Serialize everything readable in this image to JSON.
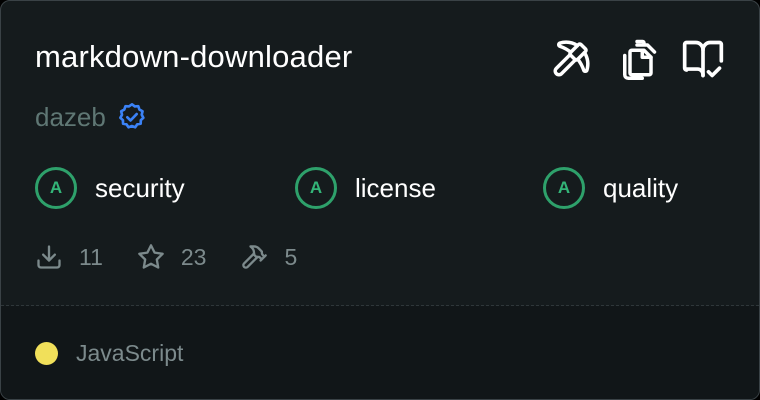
{
  "server": {
    "name": "markdown-downloader",
    "author": "dazeb"
  },
  "actions": [
    {
      "icon": "pickaxe-icon"
    },
    {
      "icon": "copy-icon"
    },
    {
      "icon": "book-check-icon"
    }
  ],
  "grades": [
    {
      "grade": "A",
      "label": "security"
    },
    {
      "grade": "A",
      "label": "license"
    },
    {
      "grade": "A",
      "label": "quality"
    }
  ],
  "stats": {
    "downloads": "11",
    "stars": "23",
    "tools": "5"
  },
  "language": {
    "name": "JavaScript",
    "color": "#f1e05a"
  },
  "colors": {
    "background": "#151b1d",
    "grade_accent": "#2ea16b",
    "verified": "#3b82f6",
    "muted_text": "#7c8a8c"
  }
}
